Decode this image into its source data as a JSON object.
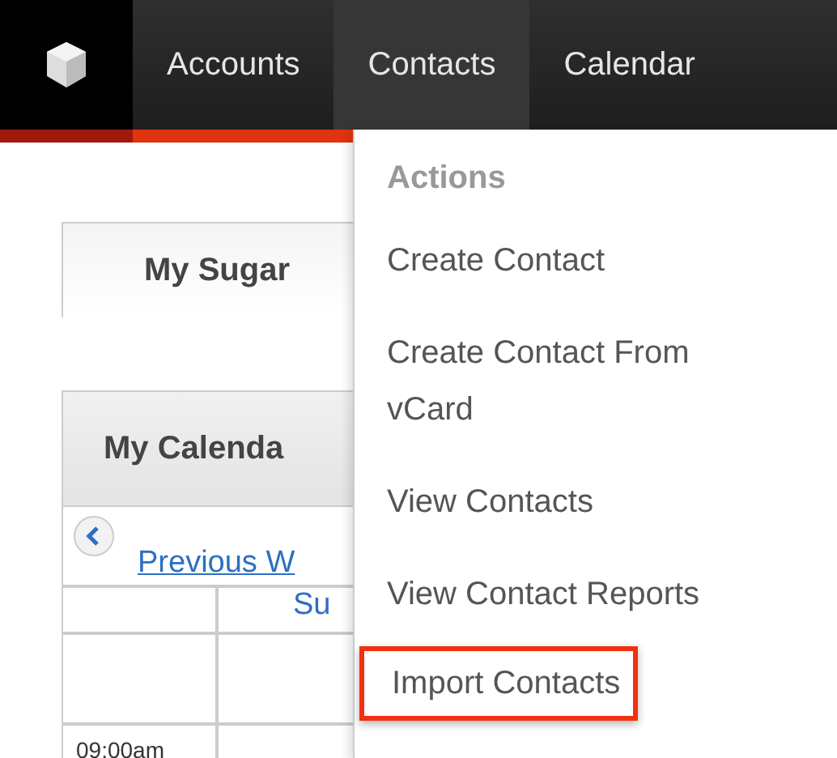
{
  "nav": {
    "items": [
      {
        "label": "Accounts",
        "selected": false
      },
      {
        "label": "Contacts",
        "selected": true
      },
      {
        "label": "Calendar",
        "selected": false
      }
    ]
  },
  "dropdown": {
    "heading": "Actions",
    "items": [
      {
        "label": "Create Contact",
        "highlighted": false
      },
      {
        "label": "Create Contact From vCard",
        "highlighted": false
      },
      {
        "label": "View Contacts",
        "highlighted": false
      },
      {
        "label": "View Contact Reports",
        "highlighted": false
      },
      {
        "label": "Import Contacts",
        "highlighted": true
      }
    ]
  },
  "tabs": [
    {
      "label": "My Sugar",
      "selected": true
    }
  ],
  "dashlet": {
    "title": "My Calenda",
    "previous_link": "Previous W",
    "day_header": "Su",
    "time_label": "09:00am"
  }
}
